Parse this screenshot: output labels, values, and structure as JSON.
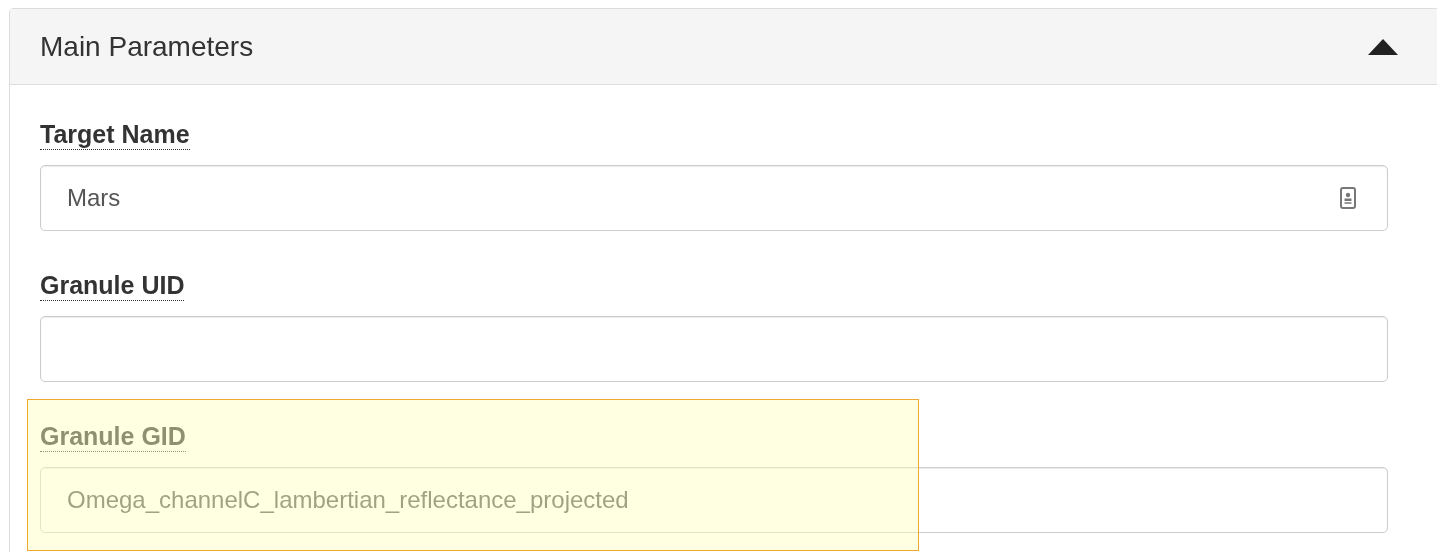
{
  "panel": {
    "title": "Main Parameters",
    "expanded": true
  },
  "fields": [
    {
      "label": "Target Name",
      "value": "Mars",
      "kind": "autocomplete",
      "highlighted": false
    },
    {
      "label": "Granule UID",
      "kind": "text",
      "highlighted": false
    },
    {
      "label": "Granule GID",
      "value": "Omega_channelC_lambertian_reflectance_projected",
      "kind": "text",
      "highlighted": true
    }
  ]
}
